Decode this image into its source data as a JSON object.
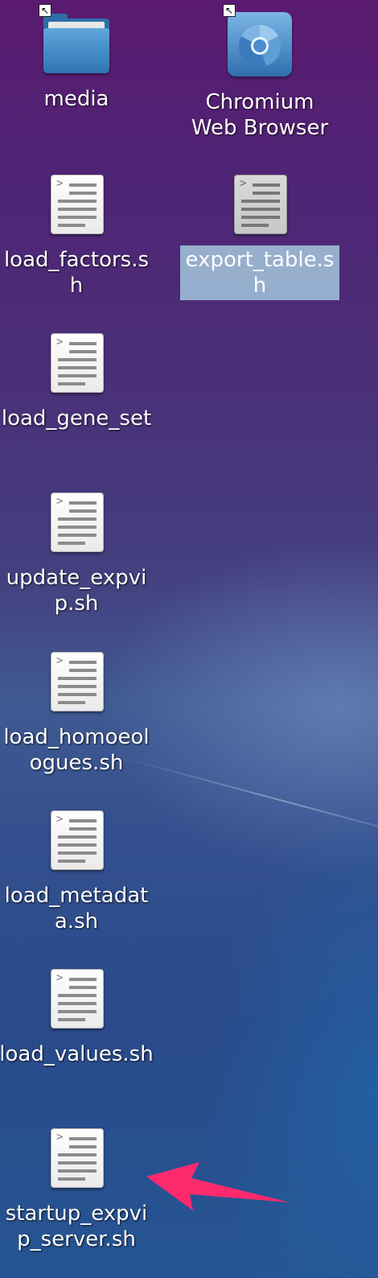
{
  "desktop": {
    "icons": [
      {
        "label": "media",
        "type": "folder",
        "shortcut": true,
        "selected": false
      },
      {
        "label": "Chromium Web Browser",
        "type": "browser",
        "shortcut": true,
        "selected": false
      },
      {
        "label": "load_factors.sh",
        "type": "script",
        "shortcut": false,
        "selected": false
      },
      {
        "label": "export_table.sh",
        "type": "script",
        "shortcut": false,
        "selected": true
      },
      {
        "label": "load_gene_set",
        "type": "script",
        "shortcut": false,
        "selected": false
      },
      {
        "label": "update_expvip.sh",
        "type": "script",
        "shortcut": false,
        "selected": false
      },
      {
        "label": "load_homoeologues.sh",
        "type": "script",
        "shortcut": false,
        "selected": false
      },
      {
        "label": "load_metadata.sh",
        "type": "script",
        "shortcut": false,
        "selected": false
      },
      {
        "label": "load_values.sh",
        "type": "script",
        "shortcut": false,
        "selected": false
      },
      {
        "label": "startup_expvip_server.sh",
        "type": "script",
        "shortcut": false,
        "selected": false
      }
    ],
    "shortcut_glyph": "↖",
    "prompt_glyph": ">",
    "annotation_arrow_color": "#ff2a6d",
    "selection_color": "#a0bed7"
  }
}
